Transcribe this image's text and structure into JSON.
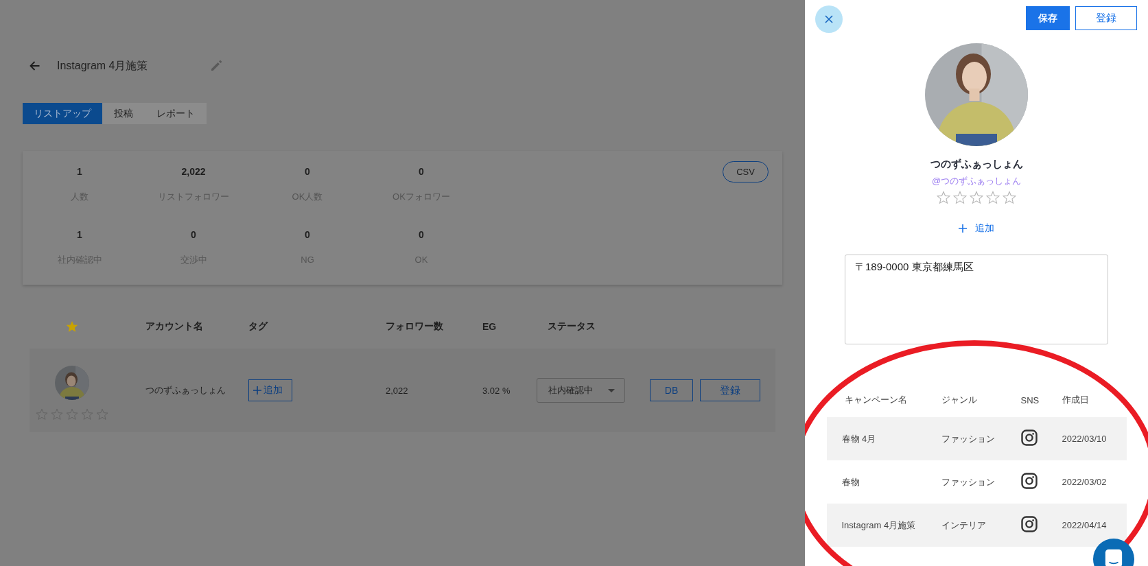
{
  "page": {
    "title": "Instagram 4月施策"
  },
  "tabs": [
    {
      "label": "リストアップ",
      "selected": true
    },
    {
      "label": "投稿",
      "selected": false
    },
    {
      "label": "レポート",
      "selected": false
    }
  ],
  "stats": [
    {
      "value": "1",
      "label": "人数"
    },
    {
      "value": "2,022",
      "label": "リストフォロワー"
    },
    {
      "value": "0",
      "label": "OK人数"
    },
    {
      "value": "0",
      "label": "OKフォロワー"
    },
    {
      "value": "1",
      "label": "社内確認中"
    },
    {
      "value": "0",
      "label": "交渉中"
    },
    {
      "value": "0",
      "label": "NG"
    },
    {
      "value": "0",
      "label": "OK"
    }
  ],
  "csv_button": "CSV",
  "table": {
    "columns": [
      "アカウント名",
      "タグ",
      "フォロワー数",
      "EG",
      "ステータス"
    ],
    "rows": [
      {
        "stars": 0,
        "account_name": "つのずふぁっしょん",
        "tag_button": "追加",
        "followers": "2,022",
        "eg": "3.02 %",
        "status": "社内確認中",
        "actions": [
          "DB",
          "登録"
        ]
      }
    ]
  },
  "drawer": {
    "buttons": [
      "保存",
      "登録"
    ],
    "name": "つのずふぁっしょん",
    "handle": "@つのずふぁっしょん",
    "stars": 0,
    "add_tag": "追加",
    "address": "〒189-0000 東京都練馬区",
    "campaigns": {
      "columns": [
        "キャンペーン名",
        "ジャンル",
        "SNS",
        "作成日"
      ],
      "rows": [
        {
          "name": "春物 4月",
          "genre": "ファッション",
          "date": "2022/03/10"
        },
        {
          "name": "春物",
          "genre": "ファッション",
          "date": "2022/03/02"
        },
        {
          "name": "Instagram 4月施策",
          "genre": "インテリア",
          "date": "2022/04/14"
        }
      ]
    }
  }
}
